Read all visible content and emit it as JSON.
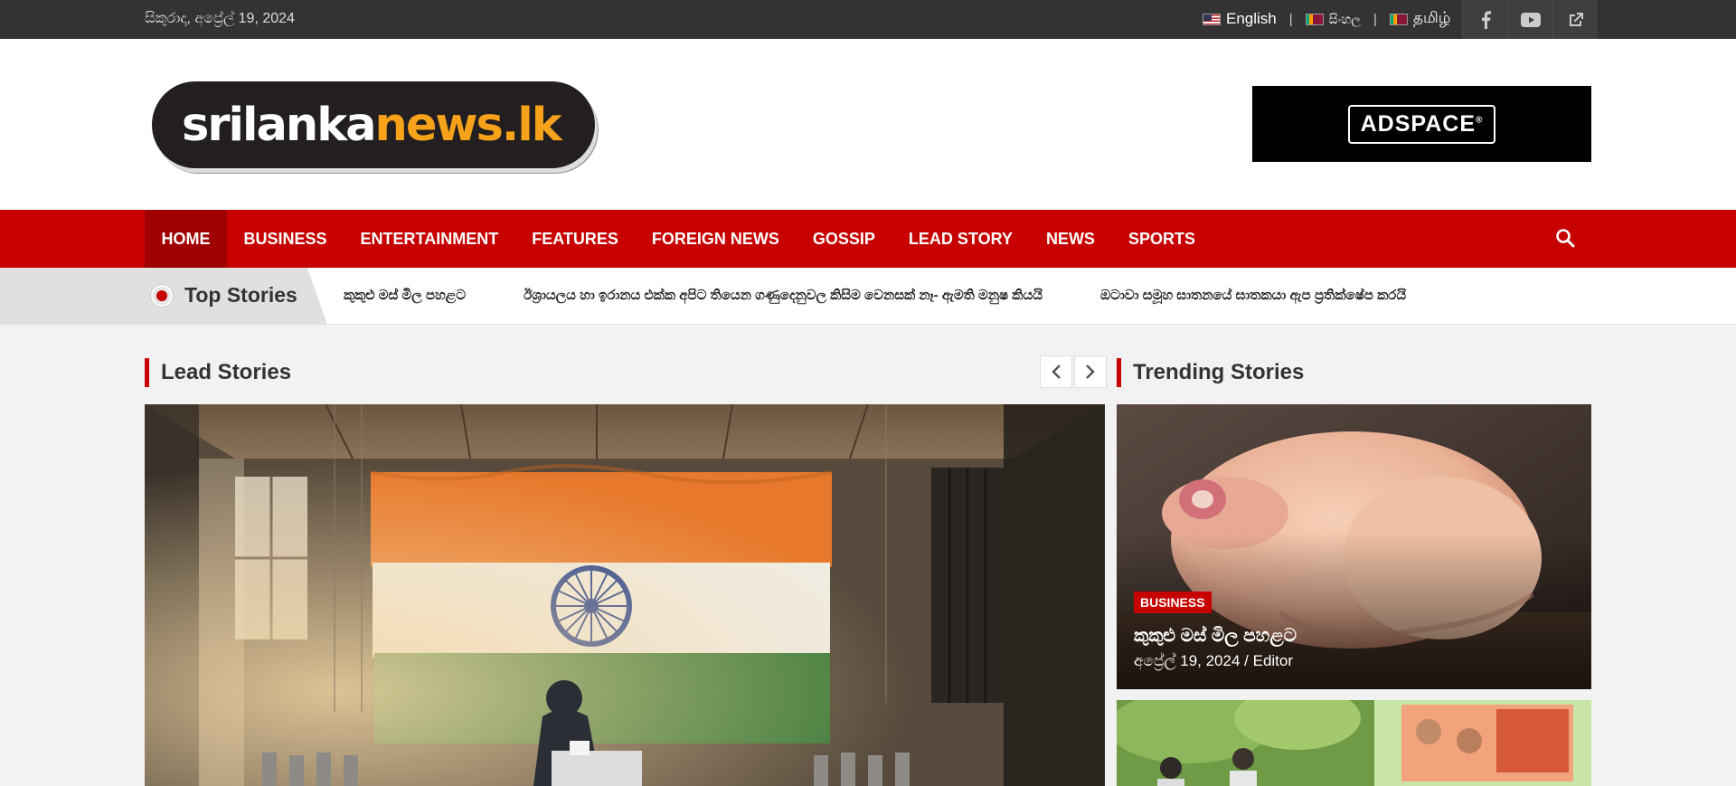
{
  "topbar": {
    "date": "සිකුරාදා, අප්‍රේල් 19, 2024",
    "languages": [
      {
        "label": "English",
        "flag": "us-flag-icon"
      },
      {
        "label": "සිංහල",
        "flag": "lk-flag-icon"
      },
      {
        "label": "தமிழ்",
        "flag": "lk-flag-icon"
      }
    ],
    "separator": "|",
    "social": [
      "facebook-icon",
      "youtube-icon",
      "external-link-icon"
    ]
  },
  "header": {
    "logo_white": "srilanka",
    "logo_orange": "news.lk",
    "ad_text": "ADSPACE",
    "ad_mark": "®"
  },
  "nav": {
    "items": [
      "HOME",
      "BUSINESS",
      "ENTERTAINMENT",
      "FEATURES",
      "FOREIGN NEWS",
      "GOSSIP",
      "LEAD STORY",
      "NEWS",
      "SPORTS"
    ],
    "active": "HOME"
  },
  "ticker": {
    "label": "Top Stories",
    "items": [
      "කුකුළු මස් මිල පහළට",
      "ඊශ්‍රායලය හා ඉරානය එක්ක අපිට තියෙන ගණුදෙනුවල කිසිම වෙනසක් නෑ- ඇමති මනුෂ කියයි",
      "ඔටාවා සමූහ ඝාතනයේ ඝාතකයා ඇප ප්‍රතික්ෂේප කරයි"
    ]
  },
  "lead": {
    "title": "Lead Stories"
  },
  "trending": {
    "title": "Trending Stories",
    "items": [
      {
        "category": "BUSINESS",
        "headline": "කුකුළු මස් මිල පහළට",
        "date": "අප්‍රේල් 19, 2024",
        "author_sep": " / ",
        "author": "Editor"
      }
    ]
  },
  "colors": {
    "accent": "#c70000",
    "topbar": "#333333",
    "logo_orange": "#f7a21b"
  }
}
